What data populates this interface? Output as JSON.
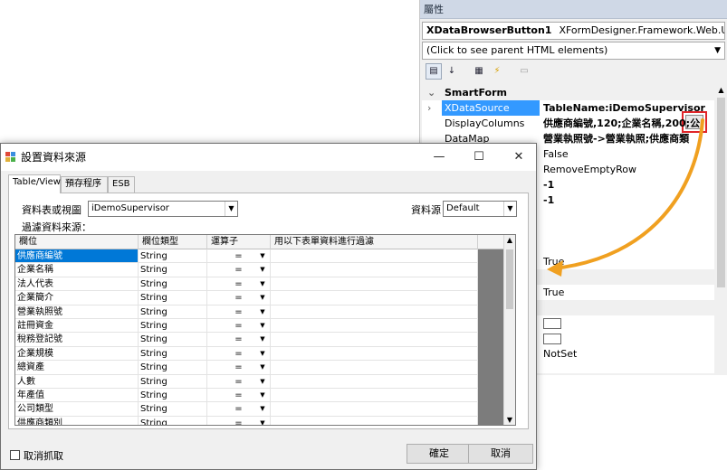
{
  "properties": {
    "title": "屬性",
    "object_name": "XDataBrowserButton1",
    "object_type": "XFormDesigner.Framework.Web.UI",
    "parent_hint": "(Click to see parent HTML elements)",
    "category": "SmartForm",
    "rows": [
      {
        "name": "XDataSource",
        "value": "TableName:iDemoSupervisor"
      },
      {
        "name": "DisplayColumns",
        "value": "供應商編號,120;企業名稱,200;公"
      },
      {
        "name": "DataMap",
        "value": "營業執照號->營業執照;供應商類"
      },
      {
        "name": "",
        "value": "False"
      },
      {
        "name": "",
        "value": "RemoveEmptyRow"
      },
      {
        "name": "",
        "value": "-1"
      },
      {
        "name": "",
        "value": "-1"
      },
      {
        "name": "",
        "value": "True"
      },
      {
        "name": "",
        "value": "True"
      },
      {
        "name": "",
        "value": "NotSet"
      }
    ],
    "ellipsis_label": "..."
  },
  "dialog": {
    "title": "設置資料來源",
    "tabs": [
      "Table/View",
      "預存程序",
      "ESB"
    ],
    "table_label": "資料表或視圖",
    "table_value": "iDemoSupervisor",
    "source_label": "資料源",
    "source_value": "Default",
    "filter_label": "過濾資料來源：",
    "columns": [
      "欄位",
      "欄位類型",
      "運算子",
      "用以下表單資料進行過濾"
    ],
    "rows": [
      {
        "field": "供應商編號",
        "type": "String",
        "op": "="
      },
      {
        "field": "企業名稱",
        "type": "String",
        "op": "="
      },
      {
        "field": "法人代表",
        "type": "String",
        "op": "="
      },
      {
        "field": "企業簡介",
        "type": "String",
        "op": "="
      },
      {
        "field": "營業執照號",
        "type": "String",
        "op": "="
      },
      {
        "field": "註冊資金",
        "type": "String",
        "op": "="
      },
      {
        "field": "稅務登記號",
        "type": "String",
        "op": "="
      },
      {
        "field": "企業規模",
        "type": "String",
        "op": "="
      },
      {
        "field": "總資產",
        "type": "String",
        "op": "="
      },
      {
        "field": "人數",
        "type": "String",
        "op": "="
      },
      {
        "field": "年產值",
        "type": "String",
        "op": "="
      },
      {
        "field": "公司類型",
        "type": "String",
        "op": "="
      },
      {
        "field": "供應商類別",
        "type": "String",
        "op": "="
      }
    ],
    "cancel_fetch_label": "取消抓取",
    "ok_label": "確定",
    "cancel_label": "取消"
  },
  "colors": {
    "selection": "#0078d7",
    "callout_arrow": "#f0a020",
    "highlight_box": "#e0262a"
  }
}
